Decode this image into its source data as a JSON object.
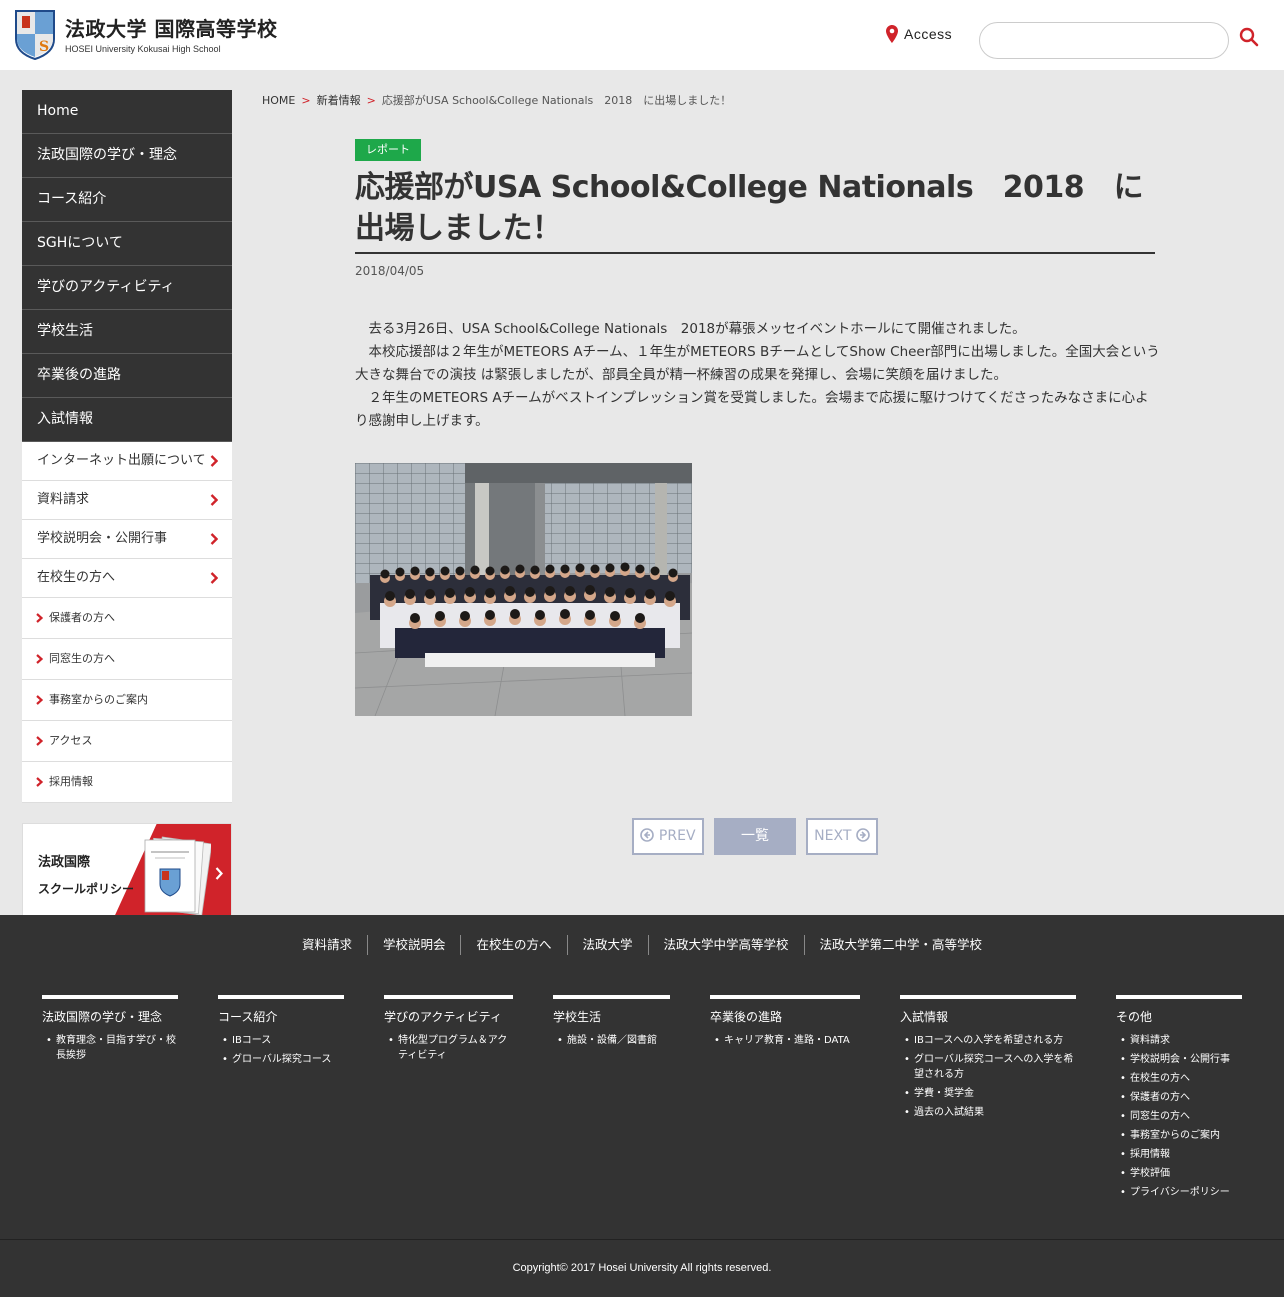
{
  "header": {
    "school_name": "法政大学 国際高等学校",
    "school_name_en": "HOSEI University Kokusai High School",
    "access_label": "Access",
    "search_placeholder": ""
  },
  "sidebar": {
    "main_items": [
      {
        "label": "Home"
      },
      {
        "label": "法政国際の学び・理念"
      },
      {
        "label": "コース紹介"
      },
      {
        "label": "SGHについて"
      },
      {
        "label": "学びのアクティビティ"
      },
      {
        "label": "学校生活"
      },
      {
        "label": "卒業後の進路"
      },
      {
        "label": "入試情報"
      }
    ],
    "sub_items": [
      {
        "label": "インターネット出願について"
      },
      {
        "label": "資料請求"
      },
      {
        "label": "学校説明会・公開行事"
      },
      {
        "label": "在校生の方へ"
      }
    ],
    "small_items": [
      {
        "label": "保護者の方へ"
      },
      {
        "label": "同窓生の方へ"
      },
      {
        "label": "事務室からのご案内"
      },
      {
        "label": "アクセス"
      },
      {
        "label": "採用情報"
      }
    ],
    "policy_banner": {
      "line1": "法政国際",
      "line2": "スクールポリシー"
    }
  },
  "breadcrumb": {
    "home": "HOME",
    "section": "新着情報",
    "current": "応援部がUSA School&College Nationals　2018　に出場しました！",
    "separator": ">"
  },
  "article": {
    "tag": "レポート",
    "title": "応援部がUSA School&College Nationals　2018　に出場しました！",
    "date": "2018/04/05",
    "paragraphs": [
      "去る3月26日、USA School&College Nationals　2018が幕張メッセイベントホールにて開催されました。",
      "本校応援部は２年生がMETEORS Aチーム、１年生がMETEORS BチームとしてShow Cheer部門に出場しました。全国大会という大きな舞台での演技 は緊張しましたが、部員全員が精一杯練習の成果を発揮し、会場に笑顔を届けました。",
      "２年生のMETEORS Aチームがベストインプレッション賞を受賞しました。会場まで応援に駆けつけてくださったみなさまに心より感謝申し上げます。"
    ]
  },
  "pager": {
    "prev": "PREV",
    "list": "一覧",
    "next": "NEXT"
  },
  "footer": {
    "links": [
      "資料請求",
      "学校説明会",
      "在校生の方へ",
      "法政大学",
      "法政大学中学高等学校",
      "法政大学第二中学・高等学校"
    ],
    "columns": [
      {
        "title": "法政国際の学び・理念",
        "items": [
          "教育理念・目指す学び・校長挨拶"
        ]
      },
      {
        "title": "コース紹介",
        "items": [
          "IBコース",
          "グローバル探究コース"
        ]
      },
      {
        "title": "学びのアクティビティ",
        "items": [
          "特化型プログラム＆アクティビティ"
        ]
      },
      {
        "title": "学校生活",
        "items": [
          "施設・設備／図書館"
        ]
      },
      {
        "title": "卒業後の進路",
        "items": [
          "キャリア教育・進路・DATA"
        ]
      },
      {
        "title": "入試情報",
        "items": [
          "IBコースへの入学を希望される方",
          "グローバル探究コースへの入学を希望される方",
          "学費・奨学金",
          "過去の入試結果"
        ]
      },
      {
        "title": "その他",
        "items": [
          "資料請求",
          "学校説明会・公開行事",
          "在校生の方へ",
          "保護者の方へ",
          "同窓生の方へ",
          "事務室からのご案内",
          "採用情報",
          "学校評価",
          "プライバシーポリシー"
        ]
      }
    ],
    "copyright": "Copyright© 2017 Hosei University All rights reserved."
  },
  "colors": {
    "accent_red": "#d0232a",
    "tag_green": "#1ea84a",
    "nav_dark": "#333333",
    "pager": "#a6aec4"
  }
}
